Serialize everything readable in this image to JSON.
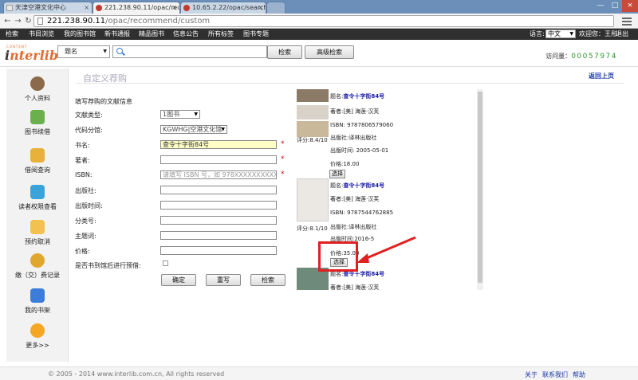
{
  "browser": {
    "tabs": [
      {
        "label": "天津空港文化中心"
      },
      {
        "label": "221.238.90.11/opac/recomm"
      },
      {
        "label": "10.65.2.22/opac/search"
      },
      {
        "label": ""
      }
    ],
    "url_host": "221.238.90.11",
    "url_path": "/opac/recommend/custom"
  },
  "topnav": {
    "items": [
      "检索",
      "书目浏览",
      "我的图书馆",
      "新书通报",
      "精品图书",
      "信息公告",
      "所有标签",
      "图书专题"
    ],
    "lang_label": "语言:",
    "lang_value": "中文",
    "welcome": "欢迎您：王彤",
    "logout": "退出"
  },
  "header": {
    "logo_small": "CONTENT",
    "logo_text_i": "i",
    "logo_text_rest": "nterlib",
    "field_value": "题名",
    "search_value": "",
    "search_button": "检索",
    "advanced_button": "高级检索",
    "visits_label": "访问量：",
    "visits_count": "00057974"
  },
  "sidebar": {
    "items": [
      {
        "label": "个人资料",
        "color": "#8a6a4a"
      },
      {
        "label": "图书续借",
        "color": "#6ab04c"
      },
      {
        "label": "借阅查询",
        "color": "#e7b13a"
      },
      {
        "label": "读者权限查看",
        "color": "#3aa3d9"
      },
      {
        "label": "预约取消",
        "color": "#f2c14e"
      },
      {
        "label": "缴（交）费记录",
        "color": "#e0a72e"
      },
      {
        "label": "我的书架",
        "color": "#3b7dd8"
      },
      {
        "label": "更多>>",
        "color": "#f5a623"
      }
    ]
  },
  "main": {
    "title": "自定义荐购",
    "back": "返回上页"
  },
  "form": {
    "heading": "填写荐购的文献信息",
    "doc_type_label": "文献类型:",
    "doc_type_value": "1图书",
    "code_label": "代码分馆:",
    "code_value": "KGWHG|空港文化馆",
    "title_label": "书名:",
    "title_value": "查令十字街84号",
    "author_label": "著者:",
    "author_value": "",
    "isbn_label": "ISBN:",
    "isbn_placeholder": "请填写 ISBN 号，如 978XXXXXXXXXX",
    "publisher_label": "出版社:",
    "pubdate_label": "出版时间:",
    "classno_label": "分类号:",
    "subject_label": "主题词:",
    "price_label": "价格:",
    "reserve_label": "是否书到馆后进行预借:",
    "req_mark": "*",
    "confirm": "确定",
    "reset": "重写",
    "search": "检索"
  },
  "results": [
    {
      "title_label": "题名:",
      "title": "查令十字街84号",
      "author": "著者:[美] 海莲·汉芙",
      "isbn": "ISBN: 9787806579060",
      "score": "评分:8.4/10",
      "publisher": "出版社:译林出版社",
      "pubdate": "出版时间: 2005-05-01",
      "price": "价格:18.00",
      "select": "选择"
    },
    {
      "title_label": "题名:",
      "title": "查令十字街84号",
      "author": "著者:[美] 海莲·汉芙",
      "isbn": "ISBN: 9787544762885",
      "score": "评分:8.1/10",
      "publisher": "出版社:译林出版社",
      "pubdate": "出版时间:2016-5",
      "price": "价格:35.00",
      "select": "选择"
    },
    {
      "title_label": "题名:",
      "title": "查令十字街84号",
      "author": "著者:[美] 海莲·汉芙"
    }
  ],
  "footer": {
    "copyright": "© 2005 - 2014 www.interlib.com.cn, All rights reserved",
    "about": "关于",
    "contact": "联系我们",
    "help": "帮助"
  },
  "colors": {
    "accent_link": "#1a3aa8",
    "required": "#dd0000",
    "highlight": "#e02020",
    "title_fill": "#ffffc6"
  }
}
